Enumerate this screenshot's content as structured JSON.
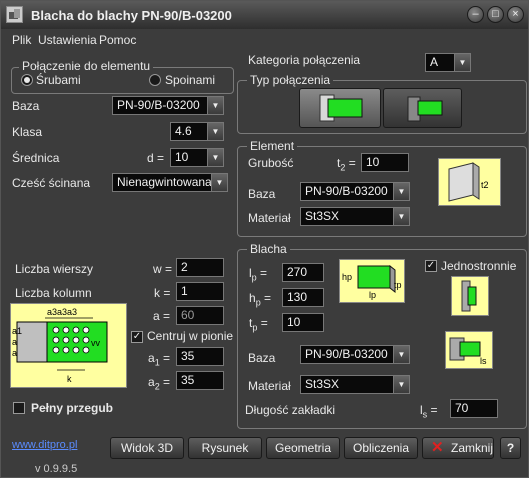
{
  "window": {
    "title": "Blacha do blachy  PN-90/B-03200"
  },
  "menu": [
    "Plik",
    "Ustawienia",
    "Pomoc"
  ],
  "connection": {
    "group_title": "Połączenie do elementu",
    "option_bolts": "Śrubami",
    "option_welds": "Spoinami",
    "baza_label": "Baza",
    "baza_value": "PN-90/B-03200",
    "klasa_label": "Klasa",
    "klasa_value": "4.6",
    "srednica_label": "Średnica",
    "d_label": "d =",
    "srednica_value": "10",
    "czesc_label": "Cześć ścinana",
    "czesc_value": "Nienagwintowana"
  },
  "bolt_grid": {
    "rows_label": "Liczba wierszy",
    "w_label": "w =",
    "w_value": "2",
    "cols_label": "Liczba kolumn",
    "k_label": "k =",
    "k_value": "1",
    "a_label": "a =",
    "a_value": "60",
    "center_label": "Centruj w pionie",
    "a1_label": "a",
    "a1_sub": "1",
    "a1_eq": " =",
    "a1_value": "35",
    "a2_label": "a",
    "a2_sub": "2",
    "a2_eq": " =",
    "a2_value": "35",
    "pin_label": "Pełny przegub",
    "diagram": {
      "top_label": "a3a3a3",
      "side_labels": [
        "a1",
        "a",
        "a"
      ],
      "v_label": "vv",
      "k_label": "k"
    }
  },
  "category": {
    "label": "Kategoria połączenia",
    "value": "A"
  },
  "connection_type": {
    "group_title": "Typ połączenia"
  },
  "element": {
    "group_title": "Element",
    "thickness_label": "Grubość",
    "t2_label": "t",
    "t2_sub": "2",
    "t2_eq": " =",
    "t2_value": "10",
    "baza_label": "Baza",
    "baza_value": "PN-90/B-03200",
    "material_label": "Materiał",
    "material_value": "St3SX",
    "diagram": {
      "t_label": "t2"
    }
  },
  "plate": {
    "group_title": "Blacha",
    "lp_label": "l",
    "lp_sub": "p",
    "lp_eq": " =",
    "lp_value": "270",
    "hp_label": "h",
    "hp_sub": "p",
    "hp_eq": " =",
    "hp_value": "130",
    "tp_label": "t",
    "tp_sub": "p",
    "tp_eq": " =",
    "tp_value": "10",
    "one_sided_label": "Jednostronnie",
    "baza_label": "Baza",
    "baza_value": "PN-90/B-03200",
    "material_label": "Materiał",
    "material_value": "St3SX",
    "overlap_label": "Długość zakładki",
    "ls_label": "l",
    "ls_sub": "s",
    "ls_eq": " =",
    "ls_value": "70",
    "diagram": {
      "hp": "hp",
      "lp": "lp",
      "tp": "tp",
      "ls": "ls"
    }
  },
  "footer": {
    "link": "www.ditpro.pl",
    "version": "v 0.9.9.5",
    "view3d": "Widok 3D",
    "drawing": "Rysunek",
    "geometry": "Geometria",
    "calculations": "Obliczenia",
    "close": "Zamknij",
    "help": "?"
  },
  "colors": {
    "accent_green": "#22dd22",
    "diagram_bg": "#ffffa0",
    "link": "#5a8cff",
    "close_x": "#e02020"
  }
}
